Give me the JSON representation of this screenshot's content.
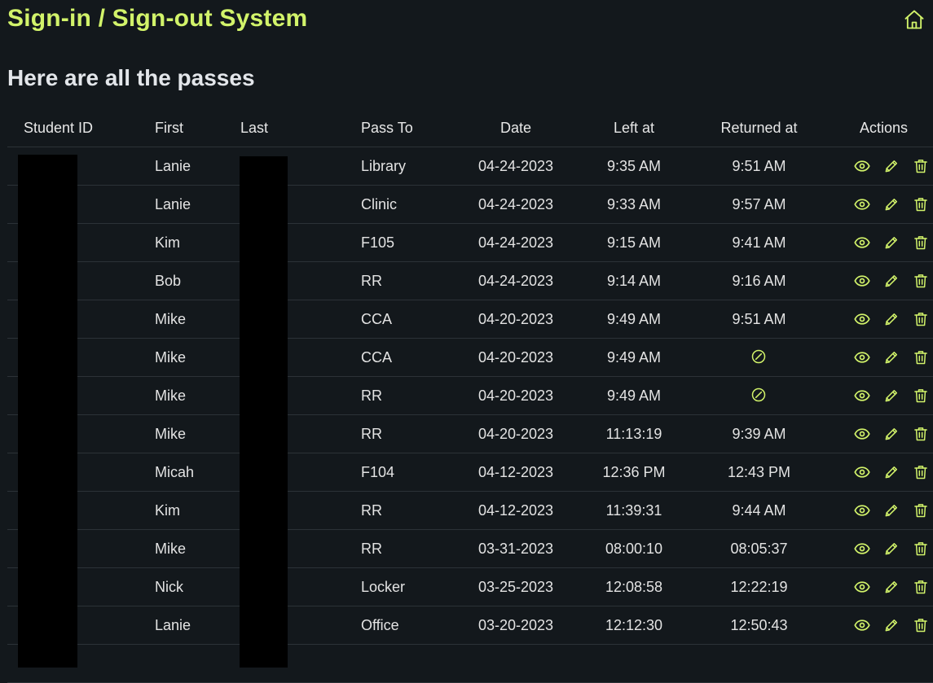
{
  "header": {
    "app_title": "Sign-in / Sign-out System",
    "home_icon": "home-icon"
  },
  "page": {
    "heading": "Here are all the passes"
  },
  "colors": {
    "accent": "#d2f36a",
    "background": "#13181c",
    "divider": "#2c3237"
  },
  "table": {
    "columns": [
      "Student ID",
      "First",
      "Last",
      "Pass To",
      "Date",
      "Left at",
      "Returned at",
      "Actions"
    ],
    "rows": [
      {
        "student_id": "",
        "first": "Lanie",
        "last": "",
        "pass_to": "Library",
        "date": "04-24-2023",
        "left_at": "9:35 AM",
        "returned_at": "9:51 AM"
      },
      {
        "student_id": "",
        "first": "Lanie",
        "last": "",
        "pass_to": "Clinic",
        "date": "04-24-2023",
        "left_at": "9:33 AM",
        "returned_at": "9:57 AM"
      },
      {
        "student_id": "",
        "first": "Kim",
        "last": "",
        "pass_to": "F105",
        "date": "04-24-2023",
        "left_at": "9:15 AM",
        "returned_at": "9:41 AM"
      },
      {
        "student_id": "",
        "first": "Bob",
        "last": "",
        "pass_to": "RR",
        "date": "04-24-2023",
        "left_at": "9:14 AM",
        "returned_at": "9:16 AM"
      },
      {
        "student_id": "",
        "first": "Mike",
        "last": "",
        "pass_to": "CCA",
        "date": "04-20-2023",
        "left_at": "9:49 AM",
        "returned_at": "9:51 AM"
      },
      {
        "student_id": "",
        "first": "Mike",
        "last": "",
        "pass_to": "CCA",
        "date": "04-20-2023",
        "left_at": "9:49 AM",
        "returned_at": null
      },
      {
        "student_id": "",
        "first": "Mike",
        "last": "",
        "pass_to": "RR",
        "date": "04-20-2023",
        "left_at": "9:49 AM",
        "returned_at": null
      },
      {
        "student_id": "",
        "first": "Mike",
        "last": "",
        "pass_to": "RR",
        "date": "04-20-2023",
        "left_at": "11:13:19",
        "returned_at": "9:39 AM"
      },
      {
        "student_id": "",
        "first": "Micah",
        "last": "",
        "pass_to": "F104",
        "date": "04-12-2023",
        "left_at": "12:36 PM",
        "returned_at": "12:43 PM"
      },
      {
        "student_id": "",
        "first": "Kim",
        "last": "",
        "pass_to": "RR",
        "date": "04-12-2023",
        "left_at": "11:39:31",
        "returned_at": "9:44 AM"
      },
      {
        "student_id": "",
        "first": "Mike",
        "last": "",
        "pass_to": "RR",
        "date": "03-31-2023",
        "left_at": "08:00:10",
        "returned_at": "08:05:37"
      },
      {
        "student_id": "",
        "first": "Nick",
        "last": "",
        "pass_to": "Locker",
        "date": "03-25-2023",
        "left_at": "12:08:58",
        "returned_at": "12:22:19"
      },
      {
        "student_id": "",
        "first": "Lanie",
        "last": "",
        "pass_to": "Office",
        "date": "03-20-2023",
        "left_at": "12:12:30",
        "returned_at": "12:50:43"
      },
      {
        "student_id": "",
        "first": "",
        "last": "",
        "pass_to": "",
        "date": "",
        "left_at": "",
        "returned_at": ""
      }
    ],
    "row_actions": [
      "view-icon",
      "edit-icon",
      "delete-icon"
    ],
    "not_returned_icon": "not-returned-icon"
  }
}
